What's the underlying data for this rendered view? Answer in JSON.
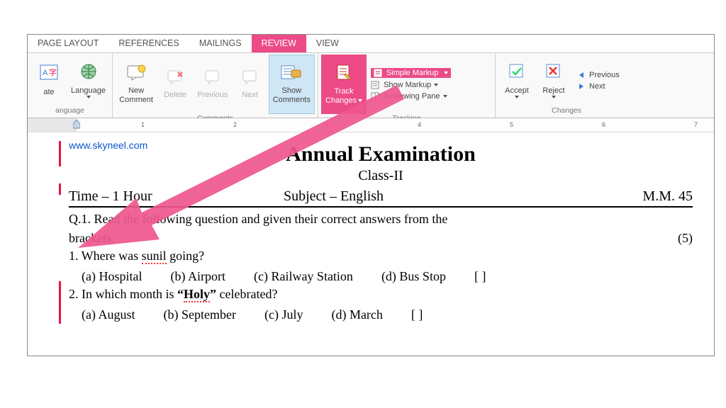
{
  "tabs": {
    "page_layout": "PAGE LAYOUT",
    "references": "REFERENCES",
    "mailings": "MAILINGS",
    "review": "REVIEW",
    "view": "VIEW"
  },
  "ribbon": {
    "language_group": {
      "label": "anguage",
      "translate": "ate",
      "language": "Language"
    },
    "comments_group": {
      "label": "Comments",
      "new_comment_l1": "New",
      "new_comment_l2": "Comment",
      "delete": "Delete",
      "previous": "Previous",
      "next": "Next",
      "show_l1": "Show",
      "show_l2": "Comments"
    },
    "tracking_group": {
      "label": "Tracking",
      "track_l1": "Track",
      "track_l2": "Changes",
      "simple_markup": "Simple Markup",
      "show_markup": "Show Markup",
      "reviewing_pane": "Reviewing Pane"
    },
    "changes_group": {
      "label": "Changes",
      "accept": "Accept",
      "reject": "Reject",
      "previous": "Previous",
      "next": "Next"
    }
  },
  "ruler": {
    "ticks": [
      "1",
      "2",
      "3",
      "4",
      "5",
      "6",
      "7"
    ]
  },
  "doc": {
    "watermark": "www.skyneel.com",
    "title": "Annual Examination",
    "class": "Class-II",
    "time": "Time – 1 Hour",
    "subject": "Subject – English",
    "mm": "M.M. 45",
    "q1": "Q.1. Read the following question and given their correct answers from the",
    "q1b": "brackets.",
    "q1marks": "(5)",
    "q1_1": "1. Where was ",
    "q1_1_err": "sunil",
    "q1_1_end": " going?",
    "q1_1_opts": {
      "a": "(a) Hospital",
      "b": "(b) Airport",
      "c": "(c) Railway Station",
      "d": "(d) Bus Stop",
      "box": "[   ]"
    },
    "q1_2_pre": "2. In which month is ",
    "q1_2_quote_open": "“",
    "q1_2_word": "Holy",
    "q1_2_quote_close": "”",
    "q1_2_post": " celebrated?",
    "q1_2_opts": {
      "a": "(a) August",
      "b": "(b) September",
      "c": "(c) July",
      "d": "(d) March",
      "box": "[   ]"
    }
  }
}
